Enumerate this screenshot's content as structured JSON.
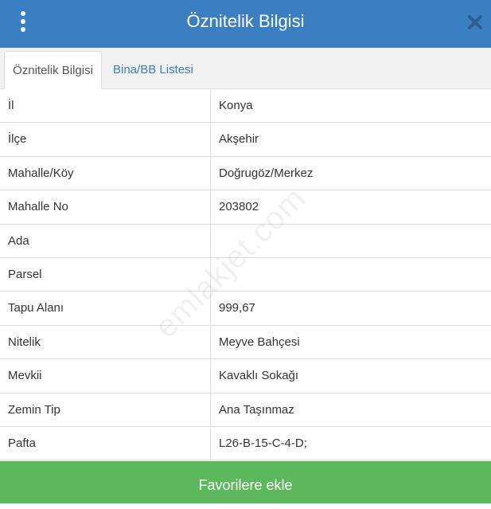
{
  "header": {
    "title": "Öznitelik Bilgisi",
    "menu_icon": "vertical-dots-icon",
    "close_icon": "close-icon"
  },
  "tabs": [
    {
      "label": "Öznitelik Bilgisi",
      "active": true
    },
    {
      "label": "Bina/BB Listesi",
      "active": false
    }
  ],
  "attributes": [
    {
      "label": "İl",
      "value": "Konya"
    },
    {
      "label": "İlçe",
      "value": "Akşehir"
    },
    {
      "label": "Mahalle/Köy",
      "value": "Doğrugöz/Merkez"
    },
    {
      "label": "Mahalle No",
      "value": "203802"
    },
    {
      "label": "Ada",
      "value": ""
    },
    {
      "label": "Parsel",
      "value": ""
    },
    {
      "label": "Tapu Alanı",
      "value": "999,67"
    },
    {
      "label": "Nitelik",
      "value": "Meyve Bahçesi"
    },
    {
      "label": "Mevkii",
      "value": "Kavaklı Sokağı"
    },
    {
      "label": "Zemin Tip",
      "value": "Ana Taşınmaz"
    },
    {
      "label": "Pafta",
      "value": "L26-B-15-C-4-D;"
    }
  ],
  "watermark": "emlakjet.com",
  "footer": {
    "button_label": "Favorilere ekle"
  },
  "colors": {
    "header": "#3a7fc1",
    "tab_link": "#3a7fc1",
    "footer_button": "#5cb85c"
  }
}
